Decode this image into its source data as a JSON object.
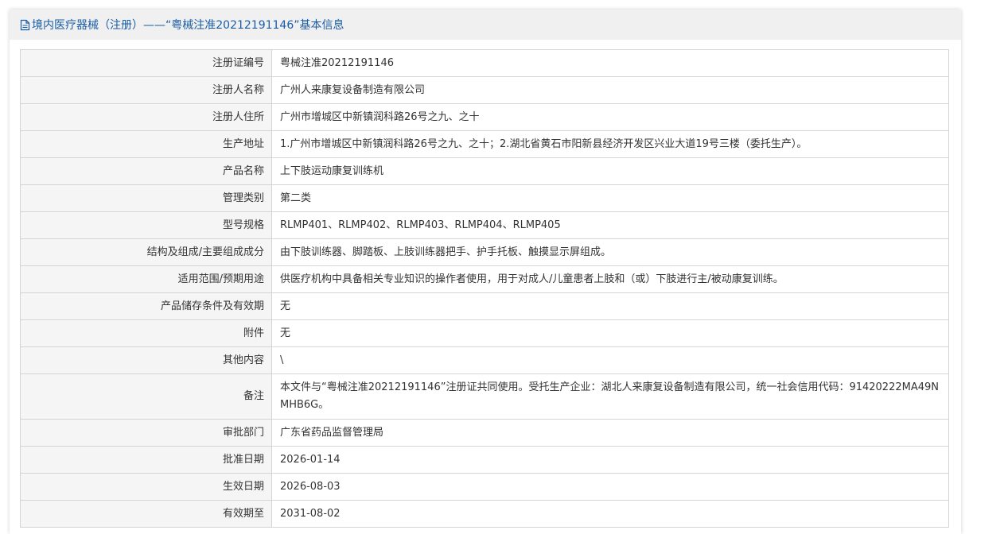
{
  "header": {
    "title": "境内医疗器械（注册）——“粤械注准20212191146”基本信息",
    "icon": "document-icon",
    "color": "#1a5da6"
  },
  "rows": [
    {
      "label": "注册证编号",
      "value": "粤械注准20212191146"
    },
    {
      "label": "注册人名称",
      "value": "广州人来康复设备制造有限公司"
    },
    {
      "label": "注册人住所",
      "value": "广州市增城区中新镇润科路26号之九、之十"
    },
    {
      "label": "生产地址",
      "value": "1.广州市增城区中新镇润科路26号之九、之十；2.湖北省黄石市阳新县经济开发区兴业大道19号三楼（委托生产）。"
    },
    {
      "label": "产品名称",
      "value": "上下肢运动康复训练机"
    },
    {
      "label": "管理类别",
      "value": "第二类"
    },
    {
      "label": "型号规格",
      "value": "RLMP401、RLMP402、RLMP403、RLMP404、RLMP405"
    },
    {
      "label": "结构及组成/主要组成成分",
      "value": "由下肢训练器、脚踏板、上肢训练器把手、护手托板、触摸显示屏组成。"
    },
    {
      "label": "适用范围/预期用途",
      "value": "供医疗机构中具备相关专业知识的操作者使用，用于对成人/儿童患者上肢和（或）下肢进行主/被动康复训练。"
    },
    {
      "label": "产品储存条件及有效期",
      "value": "无"
    },
    {
      "label": "附件",
      "value": "无"
    },
    {
      "label": "其他内容",
      "value": "\\"
    },
    {
      "label": "备注",
      "value": "本文件与“粤械注准20212191146”注册证共同使用。受托生产企业：湖北人来康复设备制造有限公司，统一社会信用代码：91420222MA49NMHB6G。"
    },
    {
      "label": "审批部门",
      "value": "广东省药品监督管理局"
    },
    {
      "label": "批准日期",
      "value": "2026-01-14"
    },
    {
      "label": "生效日期",
      "value": "2026-08-03"
    },
    {
      "label": "有效期至",
      "value": "2031-08-02"
    }
  ]
}
